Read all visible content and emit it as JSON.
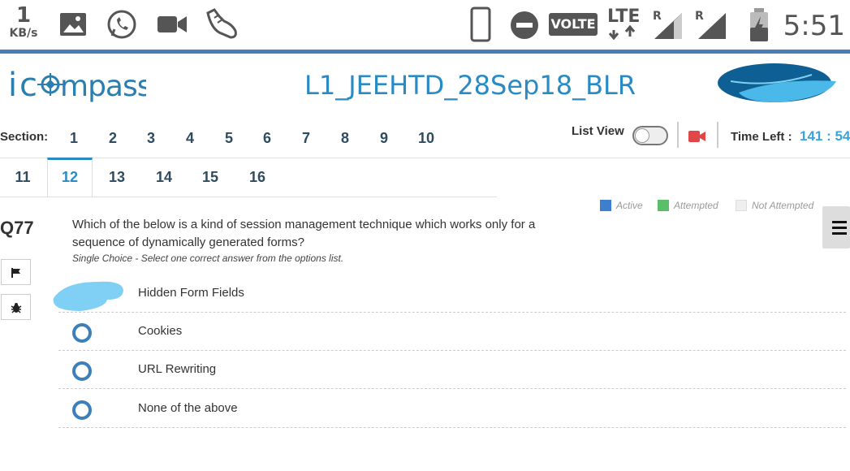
{
  "status_bar": {
    "speed_value": "1",
    "speed_unit": "KB/s",
    "volte": "VOLTE",
    "lte": "LTE",
    "roaming_1": "R",
    "roaming_2": "R",
    "time": "5:51",
    "icons": [
      "gallery-icon",
      "whatsapp-icon",
      "video-camera-icon",
      "sneaker-icon",
      "phone-icon",
      "do-not-disturb-icon",
      "signal-icon",
      "battery-icon"
    ]
  },
  "header": {
    "logo_text": "icompass",
    "title": "L1_JEEHTD_28Sep18_BLR"
  },
  "sections": {
    "label": "Section:",
    "row1": [
      "1",
      "2",
      "3",
      "4",
      "5",
      "6",
      "7",
      "8",
      "9",
      "10"
    ],
    "row2": [
      "11",
      "12",
      "13",
      "14",
      "15",
      "16"
    ],
    "active": "12"
  },
  "toolbar": {
    "list_view_label": "List View",
    "time_left_label": "Time Left :",
    "time_left_value": "141 : 54"
  },
  "legend": {
    "active": "Active",
    "attempted": "Attempted",
    "not_attempted": "Not Attempted",
    "colors": {
      "active": "#3d7fcf",
      "attempted": "#5bbf6a",
      "not_attempted": "#efefef"
    }
  },
  "question": {
    "number": "Q77",
    "text": "Which of the below is a kind of  session management technique which works only for a sequence of dynamically generated forms?",
    "hint": "Single Choice - Select one correct answer from the options list.",
    "options": [
      "Hidden Form Fields",
      "Cookies",
      "URL Rewriting",
      "None of the above"
    ]
  },
  "colors": {
    "accent": "#2a8bc4",
    "radio": "#3d7fb6",
    "status_line": "#4a7fb5"
  }
}
